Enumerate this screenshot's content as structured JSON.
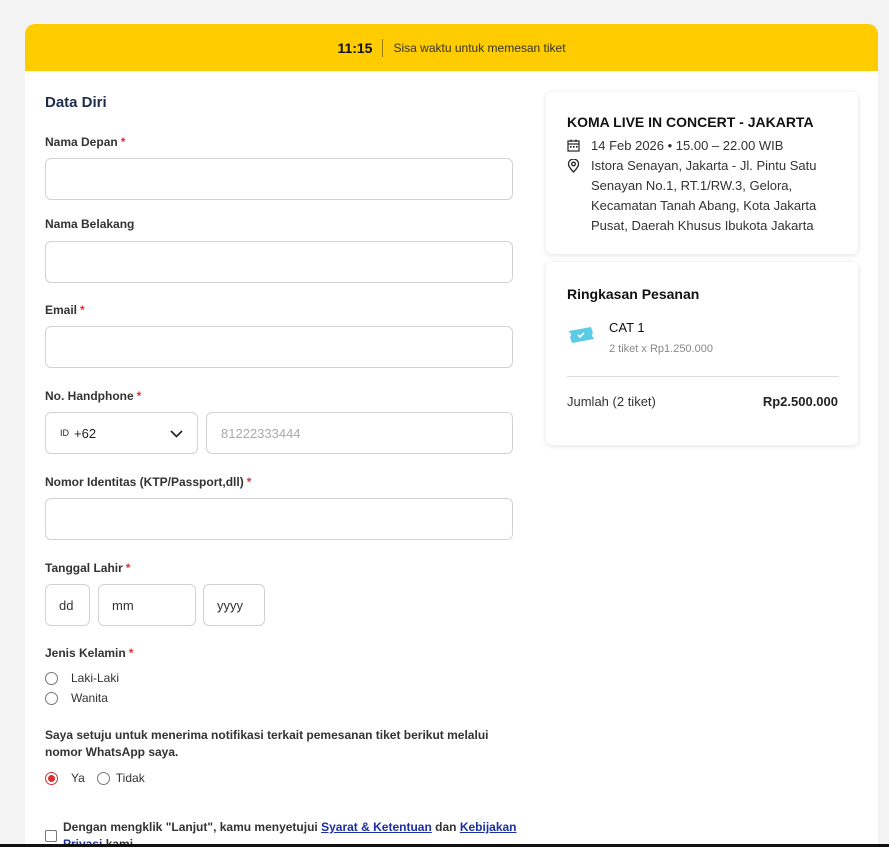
{
  "timer": {
    "time": "11:15",
    "text": "Sisa waktu untuk memesan tiket"
  },
  "form": {
    "section_title": "Data Diri",
    "first_name": {
      "label": "Nama Depan",
      "required": "*"
    },
    "last_name": {
      "label": "Nama Belakang"
    },
    "email": {
      "label": "Email",
      "required": "*"
    },
    "phone": {
      "label": "No. Handphone",
      "required": "*",
      "country_tag": "ID",
      "country_code": "+62",
      "placeholder": "81222333444"
    },
    "identity": {
      "label": "Nomor Identitas (KTP/Passport,dll)",
      "required": "*"
    },
    "birthdate": {
      "label": "Tanggal Lahir",
      "required": "*",
      "dd": "dd",
      "mm": "mm",
      "yyyy": "yyyy"
    },
    "gender": {
      "label": "Jenis Kelamin",
      "required": "*",
      "options": [
        "Laki-Laki",
        "Wanita"
      ]
    },
    "whatsapp": {
      "text": "Saya setuju untuk menerima notifikasi terkait pemesanan tiket berikut melalui nomor WhatsApp saya.",
      "options": [
        "Ya",
        "Tidak"
      ],
      "selected": "Ya"
    },
    "terms": {
      "prefix": "Dengan mengklik \"Lanjut\", kamu menyetujui ",
      "link1": "Syarat & Ketentuan",
      "middle": " dan ",
      "link2": "Kebijakan Privasi",
      "suffix": " kami"
    }
  },
  "event": {
    "title": "KOMA LIVE IN CONCERT - JAKARTA",
    "datetime": "14 Feb 2026 • 15.00 – 22.00 WIB",
    "location": "Istora Senayan, Jakarta - Jl. Pintu Satu Senayan No.1, RT.1/RW.3, Gelora, Kecamatan Tanah Abang, Kota Jakarta Pusat, Daerah Khusus Ibukota Jakarta"
  },
  "summary": {
    "title": "Ringkasan Pesanan",
    "category": "CAT 1",
    "detail": "2 tiket x Rp1.250.000",
    "total_label": "Jumlah (2 tiket)",
    "total_value": "Rp2.500.000"
  },
  "colors": {
    "accent": "#ffcc00",
    "required": "#e03030",
    "link": "#1b2fa0",
    "ticket": "#5ccbe6"
  }
}
